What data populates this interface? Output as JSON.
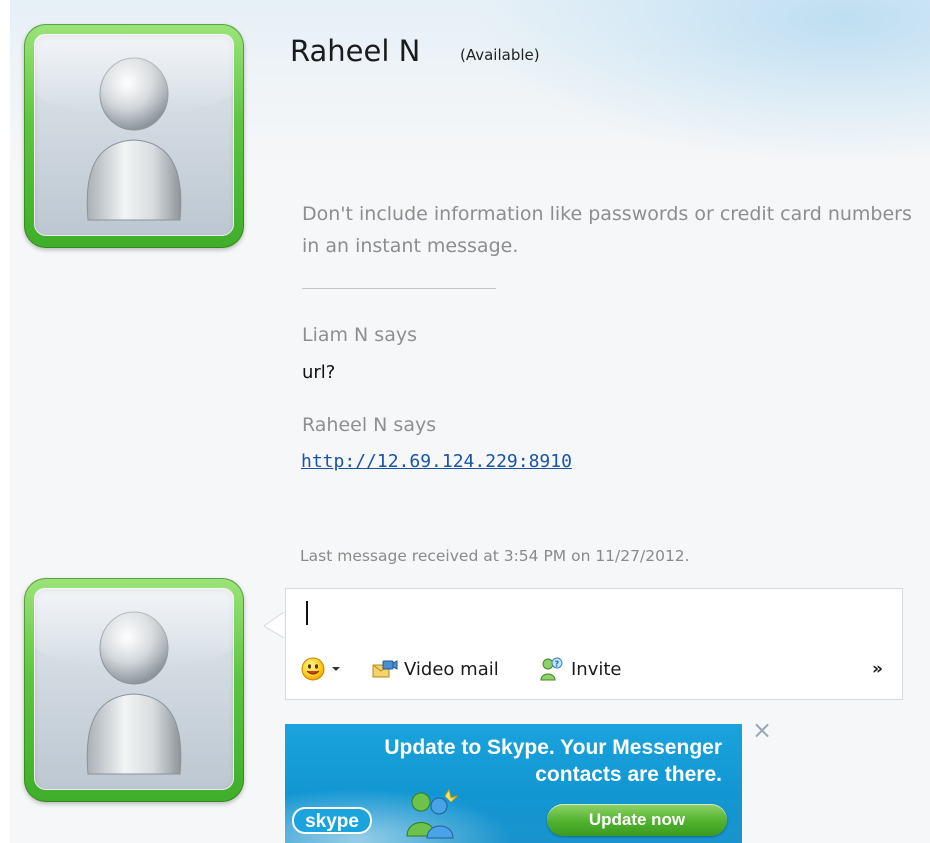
{
  "conversation": {
    "contact_name": "Raheel N",
    "contact_status": "(Available)",
    "privacy_notice": "Don't include information like passwords or credit card numbers in an instant message."
  },
  "messages": [
    {
      "sender": "Liam N says",
      "text": "url?"
    },
    {
      "sender": "Raheel N says",
      "link": "http://12.69.124.229:8910"
    }
  ],
  "last_received": "Last message received at 3:54 PM on 11/27/2012.",
  "compose": {
    "value": "",
    "toolbar": {
      "emoticon_icon": "smiley-face-icon",
      "video_mail_label": "Video mail",
      "video_mail_icon": "video-mail-icon",
      "invite_label": "Invite",
      "invite_icon": "invite-people-icon",
      "more_label": "»"
    }
  },
  "ad": {
    "headline": "Update to Skype. Your Messenger contacts are there.",
    "logo_text": "skype",
    "button_label": "Update now",
    "close_label": "×"
  },
  "colors": {
    "avatar_frame_green": "#5dc43e",
    "link_blue": "#1a54a8",
    "ad_blue": "#1296d2",
    "ad_button_green": "#4fb22d"
  }
}
